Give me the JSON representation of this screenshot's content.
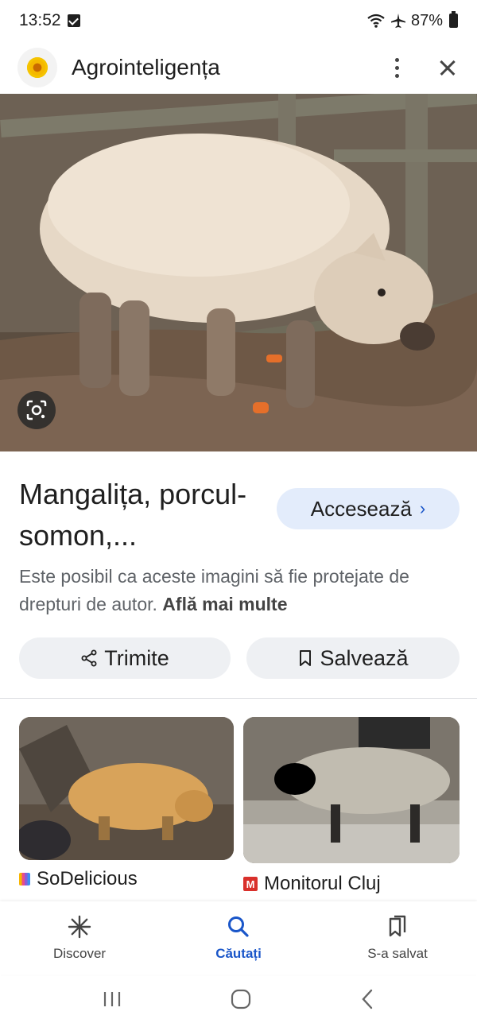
{
  "status_bar": {
    "time": "13:52",
    "battery": "87%"
  },
  "header": {
    "site_name": "Agrointeligența"
  },
  "result": {
    "title": "Mangalița, porcul-somon,...",
    "visit_label": "Accesează",
    "copyright_text": "Este posibil ca aceste imagini să fie protejate de drepturi de autor.",
    "learn_more": "Află mai multe",
    "share_label": "Trimite",
    "save_label": "Salvează"
  },
  "related": [
    {
      "source": "SoDelicious"
    },
    {
      "source": "Monitorul Cluj"
    }
  ],
  "bottom_nav": [
    {
      "label": "Discover",
      "icon": "asterisk-icon",
      "active": false
    },
    {
      "label": "Căutați",
      "icon": "search-icon",
      "active": true
    },
    {
      "label": "S-a salvat",
      "icon": "saved-icon",
      "active": false
    }
  ],
  "colors": {
    "accent": "#1a56c9",
    "visit_button_bg": "#e3ecfb",
    "chip_bg": "#eef0f3"
  }
}
